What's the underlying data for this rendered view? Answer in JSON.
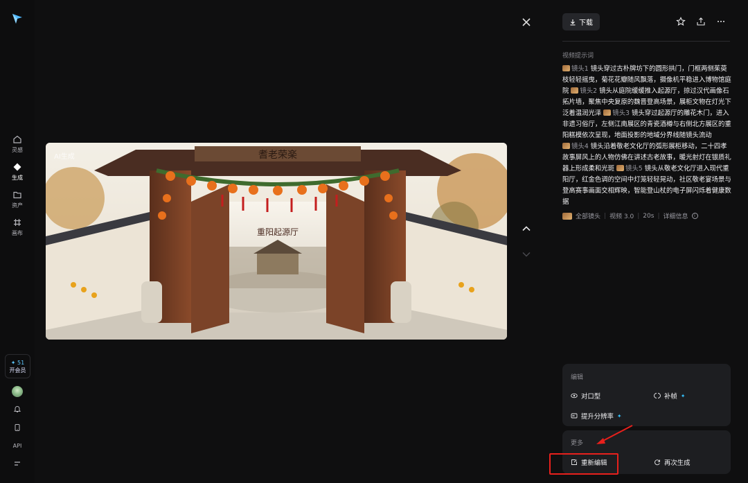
{
  "rail": {
    "items": [
      {
        "label": "灵感",
        "icon": "home-icon"
      },
      {
        "label": "生成",
        "icon": "diamond-icon"
      },
      {
        "label": "资产",
        "icon": "folder-icon"
      },
      {
        "label": "画布",
        "icon": "grid-icon"
      }
    ],
    "vip_points": "✦ 51",
    "vip_label": "开会员",
    "api_label": "API"
  },
  "image": {
    "watermark": "AI生成",
    "gate_sign": "耆老荣楽",
    "hall_sign": "重阳起源厅"
  },
  "toolbar": {
    "download_label": "下载"
  },
  "prompt": {
    "section_title": "视频提示词",
    "shots": [
      {
        "tag": "镜头1",
        "text": "镜头穿过古朴牌坊下的圆形拱门，门框两侧茱萸枝轻轻摇曳，菊花花瓣随风飘落，摄像机平稳进入博物馆庭院"
      },
      {
        "tag": "镜头2",
        "text": "镜头从庭院缓缓推入起源厅，掠过汉代画像石拓片墙，聚焦中央复原的魏晋登高场景，展柜文物在灯光下泛着温润光泽"
      },
      {
        "tag": "镜头3",
        "text": "镜头穿过起源厅的雕花木门，进入非遗习俗厅，左侧江南展区的青瓷酒樽与右侧北方展区的重阳糕模依次呈现，地面投影的地域分界线随镜头流动"
      },
      {
        "tag": "镜头4",
        "text": "镜头沿着敬老文化厅的弧形展柜移动，二十四孝故事屏风上的人物仿佛在讲述古老故事，暖光射灯在银质礼器上形成柔和光斑"
      },
      {
        "tag": "镜头5",
        "text": "镜头从敬老文化厅进入现代重阳厅，红金色调的空间中灯笼轻轻晃动，社区敬老宴场景与登高赛事画面交相辉映，智能登山杖的电子屏闪烁着健康数据"
      }
    ]
  },
  "meta": {
    "all_shots": "全部镜头",
    "model": "视频 3.0",
    "duration": "20s",
    "details": "详细信息"
  },
  "edit_card": {
    "title": "编辑",
    "lip_sync": "对口型",
    "frame_fill": "补帧",
    "upscale": "提升分辨率"
  },
  "more_card": {
    "title": "更多",
    "re_edit": "重新编辑",
    "regenerate": "再次生成"
  },
  "colors": {
    "background": "#0f0f10",
    "card": "#1d1e21",
    "accent": "#35c3ff",
    "highlight": "#e8201c"
  }
}
